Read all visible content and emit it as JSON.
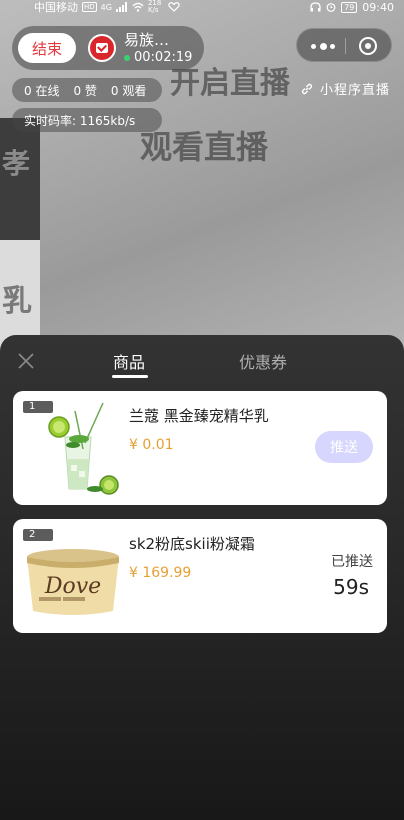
{
  "camera_text": [
    "开启直播",
    "观看直播",
    "孝",
    "乳"
  ],
  "status_bar": {
    "carrier": "中国移动",
    "hd": "HD",
    "network": "4G",
    "speed": "218 K/s",
    "battery": "79",
    "time": "09:40"
  },
  "host": {
    "end_label": "结束",
    "name": "易族…",
    "duration": "00:02:19"
  },
  "stats": {
    "online": "0 在线",
    "likes": "0 赞",
    "views": "0 观看"
  },
  "bitrate": "实时码率:  1165kb/s",
  "mini_program_live": "小程序直播",
  "panel": {
    "tabs": [
      "商品",
      "优惠券"
    ],
    "active_tab": 0,
    "items": [
      {
        "index": "1",
        "title": "兰蔻 黑金臻宠精华乳",
        "price": "¥ 0.01",
        "action_label": "推送"
      },
      {
        "index": "2",
        "title": "sk2粉底skii粉凝霜",
        "price": "¥ 169.99",
        "status_label": "已推送",
        "countdown": "59s"
      }
    ]
  }
}
